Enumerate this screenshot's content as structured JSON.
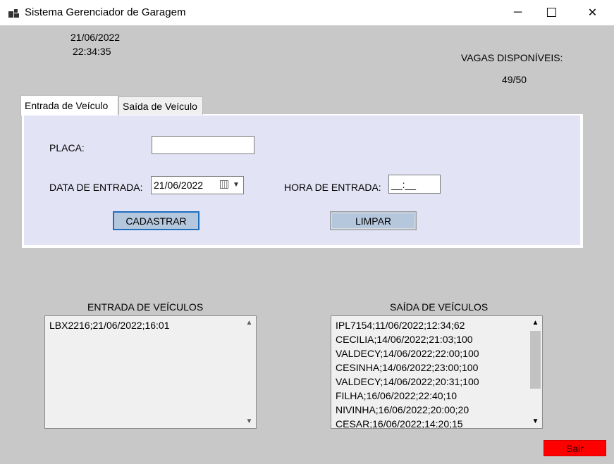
{
  "window": {
    "title": "Sistema Gerenciador de Garagem",
    "minimize_icon": "─",
    "maximize_icon": "☐",
    "close_icon": "✕"
  },
  "clock": {
    "date": "21/06/2022",
    "time": "22:34:35"
  },
  "vagas": {
    "label": "VAGAS DISPONÍVEIS:",
    "value": "49/50"
  },
  "tabs": [
    {
      "label": "Entrada de Veículo",
      "active": true
    },
    {
      "label": "Saída de Veículo",
      "active": false
    }
  ],
  "form": {
    "placa_label": "PLACA:",
    "placa_value": "",
    "data_label": "DATA DE ENTRADA:",
    "data_value": "21/06/2022",
    "hora_label": "HORA DE ENTRADA:",
    "hora_value": "__:__",
    "cadastrar_label": "CADASTRAR",
    "limpar_label": "LIMPAR"
  },
  "entrada_list": {
    "title": "ENTRADA DE VEÍCULOS",
    "items": [
      "LBX2216;21/06/2022;16:01"
    ]
  },
  "saida_list": {
    "title": "SAÍDA DE VEÍCULOS",
    "items": [
      "IPL7154;11/06/2022;12:34;62",
      "CECILIA;14/06/2022;21:03;100",
      "VALDECY;14/06/2022;22:00;100",
      "CESINHA;14/06/2022;23:00;100",
      "VALDECY;14/06/2022;20:31;100",
      "FILHA;16/06/2022;22:40;10",
      "NIVINHA;16/06/2022;20:00;20",
      "CESAR;16/06/2022;14:20;15"
    ]
  },
  "sair_label": "Sair",
  "colors": {
    "sair_bg": "#ff0000",
    "panel_bg": "#e3e3f6",
    "window_bg": "#c8c8c8",
    "button_bg": "#b5c7dc"
  }
}
